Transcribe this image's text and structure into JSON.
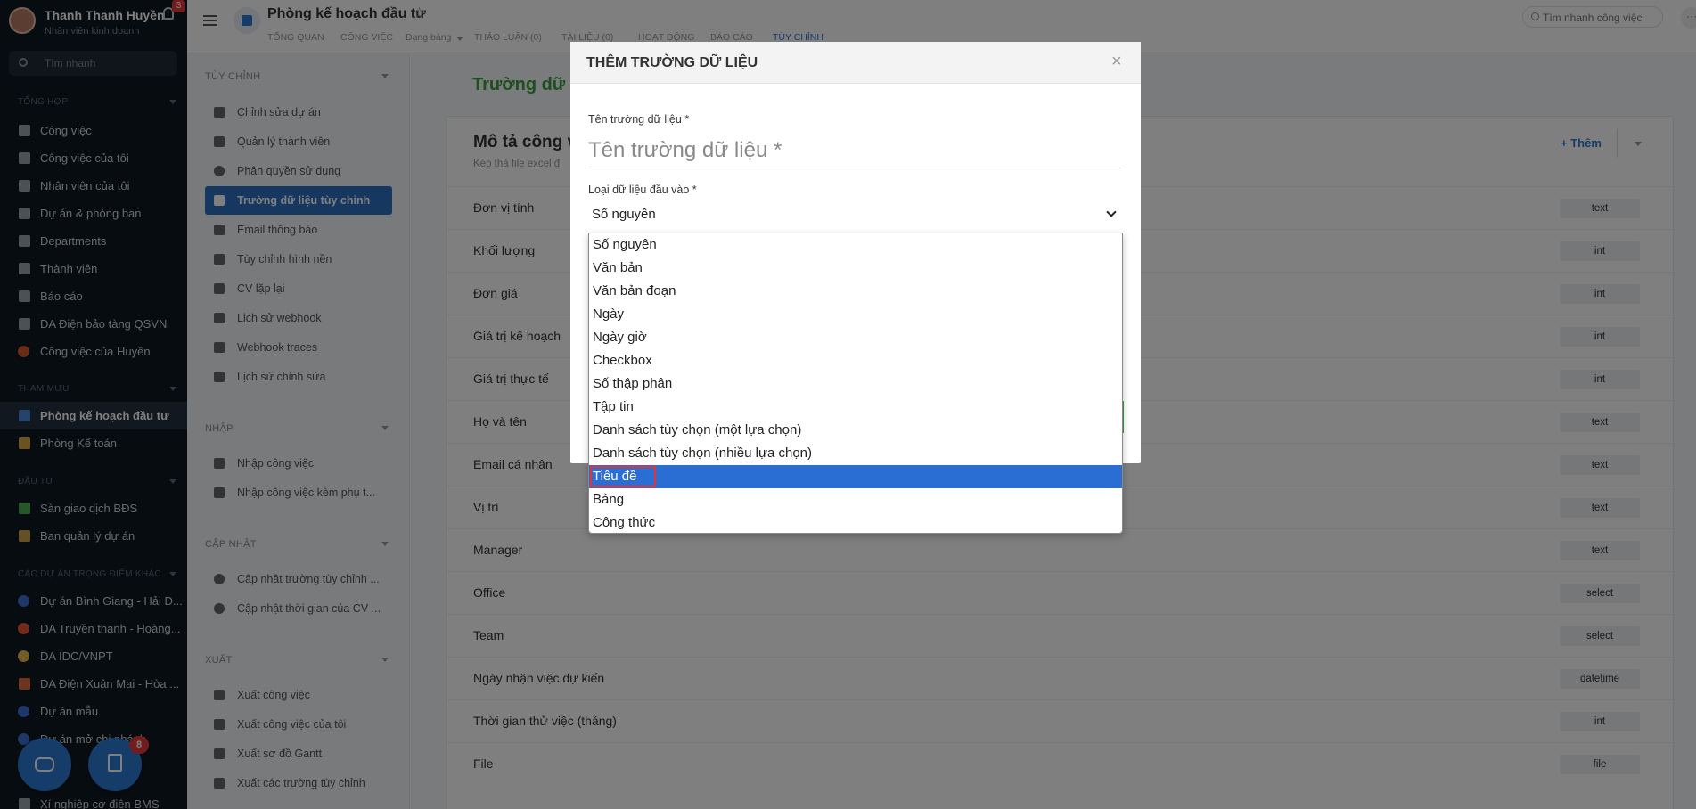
{
  "user": {
    "name": "Thanh Thanh Huyền",
    "role": "Nhân viên kinh doanh",
    "notif_count": "3"
  },
  "sidebar": {
    "search_placeholder": "Tìm nhanh",
    "sections": {
      "tong_hop": "TỔNG HỢP",
      "tham_muu": "THAM MƯU",
      "dau_tu": "ĐẦU TƯ",
      "trong_diem": "CÁC DỰ ÁN TRỌNG ĐIỂM KHÁC"
    },
    "items": [
      {
        "label": "Công việc"
      },
      {
        "label": "Công việc của tôi"
      },
      {
        "label": "Nhân viên của tôi"
      },
      {
        "label": "Dự án & phòng ban"
      },
      {
        "label": "Departments"
      },
      {
        "label": "Thành viên"
      },
      {
        "label": "Báo cáo"
      },
      {
        "label": "DA Điện bảo tàng QSVN"
      },
      {
        "label": "Công việc của Huyền"
      },
      {
        "label": "Phòng kế hoạch đầu tư"
      },
      {
        "label": "Phòng Kế toán"
      },
      {
        "label": "Sàn giao dịch BĐS"
      },
      {
        "label": "Ban quản lý dự án"
      },
      {
        "label": "Dự án Bình Giang - Hải D..."
      },
      {
        "label": "DA Truyền thanh - Hoàng..."
      },
      {
        "label": "DA IDC/VNPT"
      },
      {
        "label": "DA Điện Xuân Mai - Hòa ..."
      },
      {
        "label": "Dự án mẫu"
      },
      {
        "label": "Dự án mở chi nhánh"
      },
      {
        "label": "Xí nghiệp cơ điện BMS"
      }
    ],
    "fab_badge": "8"
  },
  "header": {
    "project_title": "Phòng kế hoạch đầu tư",
    "tabs": [
      "TỔNG QUAN",
      "CÔNG VIỆC",
      "Dạng bảng",
      "THẢO LUẬN (0)",
      "TÀI LIỆU (0)",
      "HOẠT ĐỘNG",
      "BÁO CÁO",
      "TÙY CHỈNH"
    ],
    "quick_search_placeholder": "Tìm nhanh công việc",
    "more_icon": "···"
  },
  "settings": {
    "groups": {
      "tuy_chinh": "TÙY CHỈNH",
      "nhap": "NHẬP",
      "cap_nhat": "CẬP NHẬT",
      "xuat": "XUẤT"
    },
    "items": [
      {
        "label": "Chỉnh sửa dự án"
      },
      {
        "label": "Quản lý thành viên"
      },
      {
        "label": "Phân quyền sử dụng"
      },
      {
        "label": "Trường dữ liệu tùy chỉnh"
      },
      {
        "label": "Email thông báo"
      },
      {
        "label": "Tùy chỉnh hình nền"
      },
      {
        "label": "CV lặp lại"
      },
      {
        "label": "Lịch sử webhook"
      },
      {
        "label": "Webhook traces"
      },
      {
        "label": "Lịch sử chỉnh sửa"
      },
      {
        "label": "Nhập công việc"
      },
      {
        "label": "Nhập công việc kèm phụ t..."
      },
      {
        "label": "Cập nhật trường tùy chỉnh ..."
      },
      {
        "label": "Cập nhật thời gian của CV ..."
      },
      {
        "label": "Xuất công việc"
      },
      {
        "label": "Xuất công việc của tôi"
      },
      {
        "label": "Xuất sơ đồ Gantt"
      },
      {
        "label": "Xuất các trường tùy chỉnh"
      }
    ]
  },
  "main": {
    "title": "Trường dữ li",
    "card_title": "Mô tả công v",
    "card_subtitle": "Kéo thả file excel đ",
    "add_label": "+ Thêm",
    "fields": [
      {
        "name": "Đơn vị tính",
        "type": "text"
      },
      {
        "name": "Khối lượng",
        "type": "int"
      },
      {
        "name": "Đơn giá",
        "type": "int"
      },
      {
        "name": "Giá trị kế hoạch",
        "type": "int"
      },
      {
        "name": "Giá trị thực tế",
        "type": "int"
      },
      {
        "name": "Họ và tên",
        "type": "text"
      },
      {
        "name": "Email cá nhân",
        "type": "text"
      },
      {
        "name": "Vị trí",
        "type": "text"
      },
      {
        "name": "Manager",
        "type": "text"
      },
      {
        "name": "Office",
        "type": "select"
      },
      {
        "name": "Team",
        "type": "select"
      },
      {
        "name": "Ngày nhận việc dự kiến",
        "type": "datetime"
      },
      {
        "name": "Thời gian thử việc (tháng)",
        "type": "int"
      },
      {
        "name": "File",
        "type": "file"
      }
    ]
  },
  "modal": {
    "title": "THÊM TRƯỜNG DỮ LIỆU",
    "close": "×",
    "name_label": "Tên trường dữ liệu *",
    "name_placeholder": "Tên trường dữ liệu *",
    "type_label": "Loại dữ liệu đầu vào *",
    "type_value": "Số nguyên",
    "options": [
      {
        "label": "Số nguyên"
      },
      {
        "label": "Văn bản"
      },
      {
        "label": "Văn bản đoạn"
      },
      {
        "label": "Ngày"
      },
      {
        "label": "Ngày giờ"
      },
      {
        "label": "Checkbox"
      },
      {
        "label": "Số thập phân"
      },
      {
        "label": "Tập tin"
      },
      {
        "label": "Danh sách tùy chọn (một lựa chọn)"
      },
      {
        "label": "Danh sách tùy chọn (nhiều lựa chọn)"
      },
      {
        "label": "Tiêu đề"
      },
      {
        "label": "Bảng"
      },
      {
        "label": "Công thức"
      }
    ],
    "highlighted_option": "Tiêu đề"
  },
  "colors": {
    "accent": "#2d78d4",
    "green": "#3c9e3c",
    "highlight": "#2b6ed3",
    "red_box": "#e53232"
  }
}
